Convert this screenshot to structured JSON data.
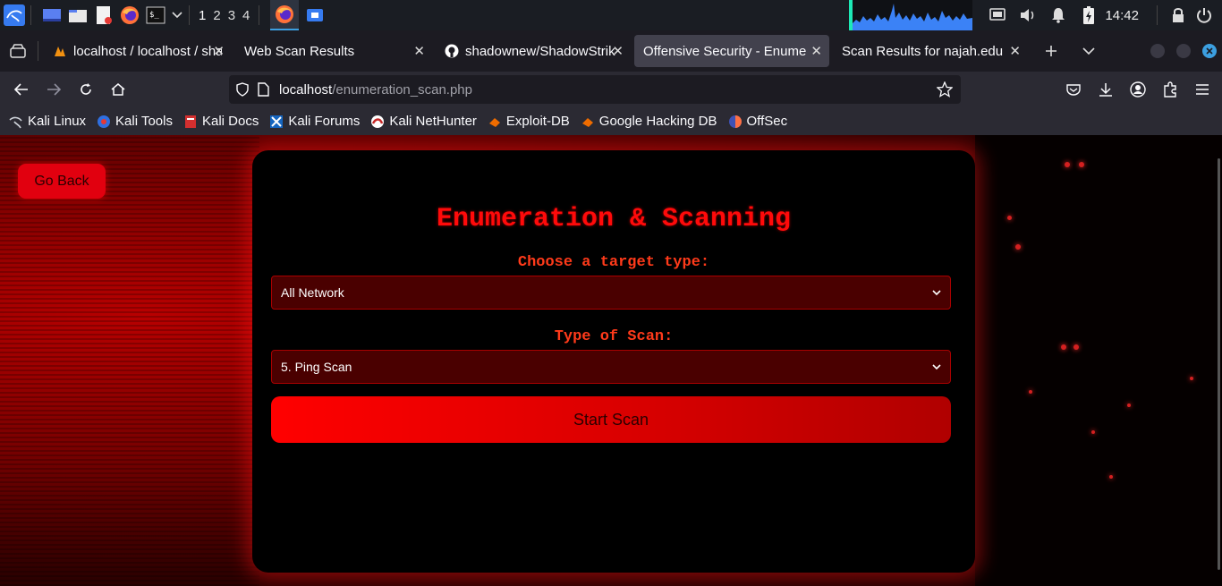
{
  "taskbar": {
    "workspaces": [
      "1",
      "2",
      "3",
      "4"
    ],
    "clock": "14:42",
    "icons": [
      "kali-menu-icon",
      "workspace-switcher-icon",
      "file-manager-icon",
      "text-editor-icon",
      "firefox-icon",
      "terminal-icon",
      "chevron-down-icon"
    ]
  },
  "tabs": [
    {
      "title": "localhost / localhost / sha",
      "favicon": "phpmyadmin-icon",
      "active": false
    },
    {
      "title": "Web Scan Results",
      "favicon": "",
      "active": false
    },
    {
      "title": "shadownew/ShadowStrik",
      "favicon": "github-icon",
      "active": false
    },
    {
      "title": "Offensive Security - Enumera",
      "favicon": "",
      "active": true
    },
    {
      "title": "Scan Results for najah.edu",
      "favicon": "",
      "active": false
    }
  ],
  "url": {
    "host": "localhost",
    "path": "/enumeration_scan.php"
  },
  "bookmarks": [
    {
      "label": "Kali Linux",
      "icon": "kali-dragon-icon"
    },
    {
      "label": "Kali Tools",
      "icon": "kali-tools-icon"
    },
    {
      "label": "Kali Docs",
      "icon": "kali-docs-icon"
    },
    {
      "label": "Kali Forums",
      "icon": "kali-forums-icon"
    },
    {
      "label": "Kali NetHunter",
      "icon": "nethunter-icon"
    },
    {
      "label": "Exploit-DB",
      "icon": "exploit-db-icon"
    },
    {
      "label": "Google Hacking DB",
      "icon": "ghdb-icon"
    },
    {
      "label": "OffSec",
      "icon": "offsec-icon"
    }
  ],
  "page": {
    "go_back": "Go Back",
    "title": "Enumeration & Scanning",
    "target_label": "Choose a target type:",
    "target_value": "All Network",
    "scan_label": "Type of Scan:",
    "scan_value": "5. Ping Scan",
    "start_button": "Start Scan"
  },
  "colors": {
    "accent": "#ff0a0a",
    "select_bg": "#4a0000",
    "button": "#e1000f"
  }
}
